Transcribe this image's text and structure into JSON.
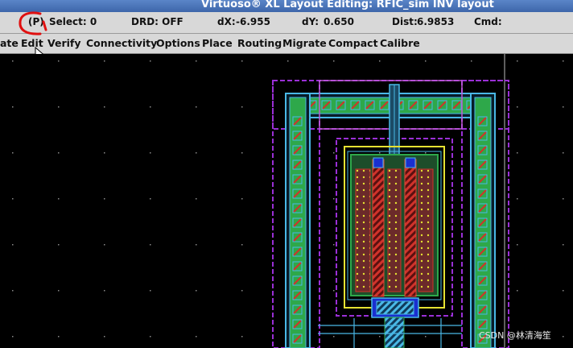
{
  "window": {
    "title": "Virtuoso® XL Layout Editing: RFIC_sim INV layout"
  },
  "status": {
    "mode": "(P)",
    "select": "Select: 0",
    "drd": "DRD: OFF",
    "dx_label": "dX:",
    "dx_value": "-6.955",
    "dy_label": "dY:",
    "dy_value": "0.650",
    "dist_label": "Dist:",
    "dist_value": "6.9853",
    "cmd_label": "Cmd:"
  },
  "menu": {
    "items": [
      "ate",
      "Edit",
      "Verify",
      "Connectivity",
      "Options",
      "Place",
      "Routing",
      "Migrate",
      "Compact",
      "Calibre"
    ]
  },
  "annotation": {
    "color": "#e01010"
  },
  "layers": {
    "metal_fill": "#49b8e6",
    "diffusion": "#2ea84a",
    "poly": "#d0332b",
    "nwell_outline": "#9a2fd6",
    "implant_outline": "#e6e232",
    "contact": "#1a2fd0"
  },
  "watermark": "CSDN @林清海笙"
}
